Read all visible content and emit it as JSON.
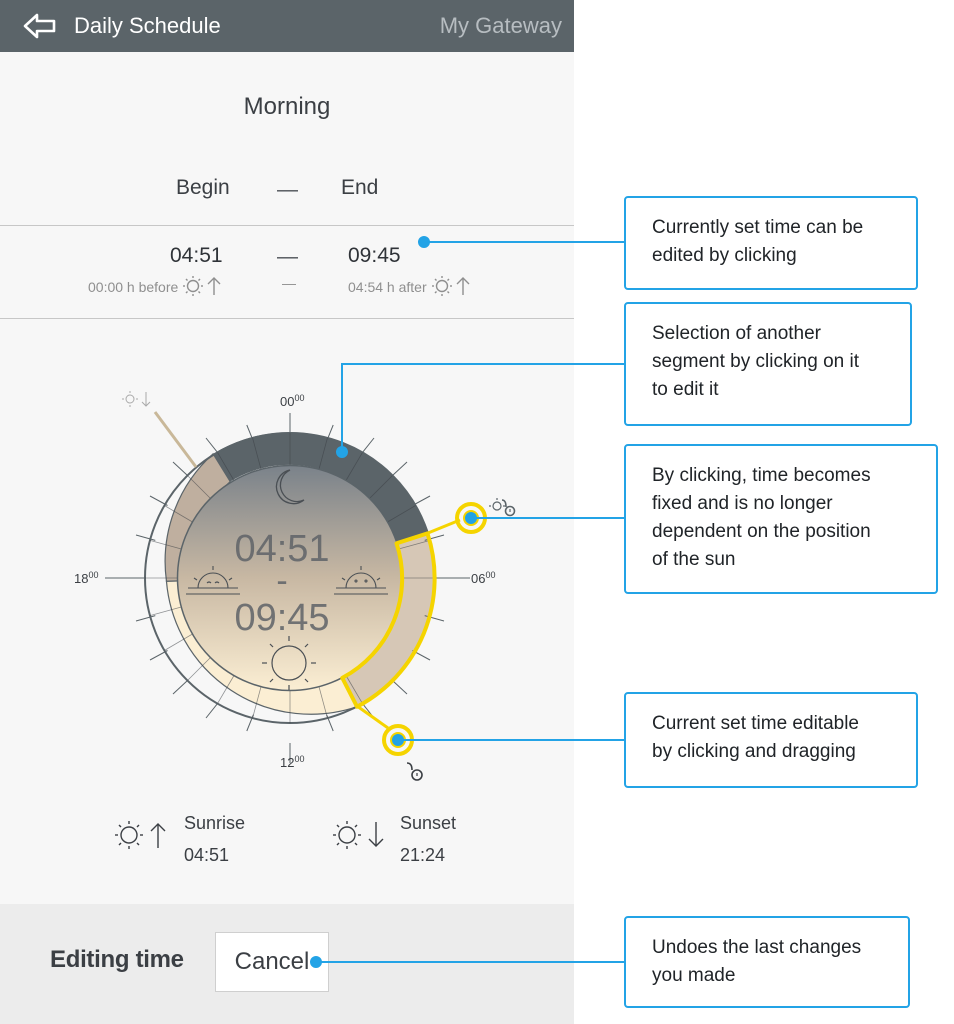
{
  "header": {
    "title": "Daily Schedule",
    "gateway": "My Gateway",
    "back_icon": "back-arrow-icon"
  },
  "segment": {
    "title": "Morning",
    "begin_label": "Begin",
    "end_label": "End",
    "separator": "—",
    "begin_time": "04:51",
    "end_time": "09:45",
    "begin_offset": "00:00 h before",
    "end_offset": "04:54 h after",
    "sub_separator": "—"
  },
  "dial": {
    "top_label": "00",
    "right_label": "06",
    "bottom_label": "12",
    "left_label": "18",
    "label_sup": "00",
    "center_begin": "04:51",
    "center_dash": "-",
    "center_end": "09:45",
    "accent_color": "#f5d400",
    "night_color": "#5b6469",
    "day_color": "#fbeed3"
  },
  "sun": {
    "sunrise_label": "Sunrise",
    "sunrise_time": "04:51",
    "sunset_label": "Sunset",
    "sunset_time": "21:24"
  },
  "footer": {
    "editing_label": "Editing time",
    "cancel_label": "Cancel"
  },
  "callouts": {
    "c1": [
      "Currently set time can be",
      "edited by clicking"
    ],
    "c2": [
      "Selection of another",
      "segment by clicking on it",
      "to edit it"
    ],
    "c3": [
      "By clicking, time becomes",
      "fixed and is no longer",
      "dependent on the position",
      "of the sun"
    ],
    "c4": [
      "Current set time editable",
      "by clicking and dragging"
    ],
    "c5": [
      "Undoes the last changes",
      "you made"
    ]
  }
}
